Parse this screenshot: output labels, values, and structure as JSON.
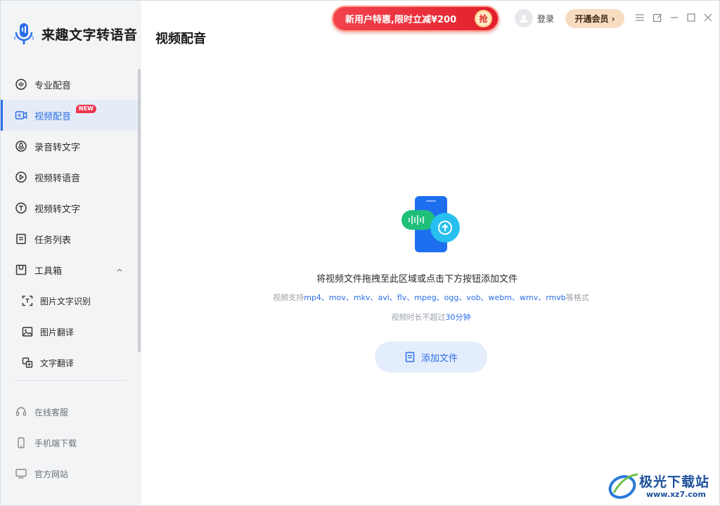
{
  "app": {
    "name": "来趣文字转语音",
    "accent": "#2a6ee8"
  },
  "sidebar": {
    "items": [
      {
        "label": "专业配音",
        "icon": "waveform-circle-icon"
      },
      {
        "label": "视频配音",
        "icon": "video-audio-icon",
        "badge": "NEW"
      },
      {
        "label": "录音转文字",
        "icon": "microphone-circle-icon"
      },
      {
        "label": "视频转语音",
        "icon": "play-circle-icon"
      },
      {
        "label": "视频转文字",
        "icon": "text-circle-icon"
      },
      {
        "label": "任务列表",
        "icon": "list-icon"
      },
      {
        "label": "工具箱",
        "icon": "toolbox-icon"
      }
    ],
    "tools": [
      {
        "label": "图片文字识别",
        "icon": "scan-text-icon"
      },
      {
        "label": "图片翻译",
        "icon": "image-icon"
      },
      {
        "label": "文字翻译",
        "icon": "translate-icon"
      }
    ],
    "bottom": [
      {
        "label": "在线客服",
        "icon": "headset-icon"
      },
      {
        "label": "手机端下载",
        "icon": "phone-icon"
      },
      {
        "label": "官方网站",
        "icon": "monitor-icon"
      }
    ]
  },
  "header": {
    "title": "视频配音",
    "promo_text": "新用户特惠,限时立减¥200",
    "promo_button": "抢",
    "login": "登录",
    "vip_button": "开通会员 ›"
  },
  "dropzone": {
    "title": "将视频文件拖拽至此区域或点击下方按钮添加文件",
    "formats_prefix": "视频支持",
    "formats": "mp4、mov、mkv、avi、flv、mpeg、ogg、vob、webm、wmv、rmvb",
    "formats_suffix": "等格式",
    "limit_prefix": "视频时长不超过",
    "limit_value": "30分钟",
    "add_button": "添加文件"
  },
  "watermark": {
    "text": "极光下载站",
    "url": "www.xz7.com"
  }
}
